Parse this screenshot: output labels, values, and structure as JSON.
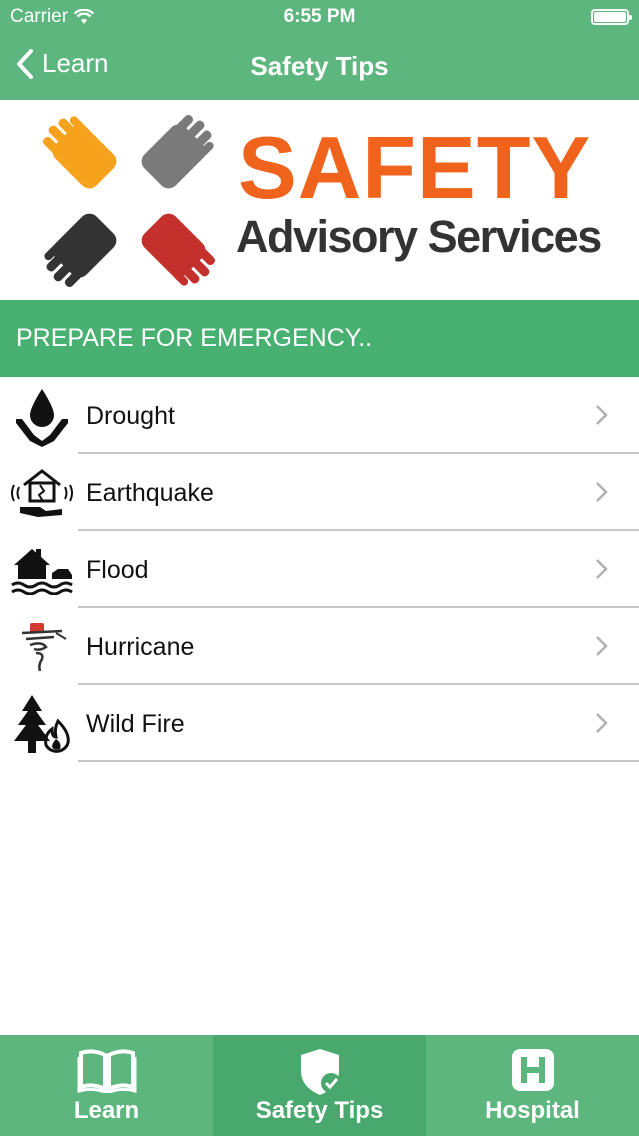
{
  "status_bar": {
    "carrier": "Carrier",
    "time": "6:55 PM"
  },
  "nav": {
    "back_label": "Learn",
    "title": "Safety Tips"
  },
  "banner": {
    "brand_line1": "SAFETY",
    "brand_line2": "Advisory Services"
  },
  "section": {
    "heading": "PREPARE FOR EMERGENCY.."
  },
  "list": {
    "items": [
      {
        "label": "Drought",
        "icon": "drought-icon"
      },
      {
        "label": "Earthquake",
        "icon": "earthquake-icon"
      },
      {
        "label": "Flood",
        "icon": "flood-icon"
      },
      {
        "label": "Hurricane",
        "icon": "hurricane-icon"
      },
      {
        "label": "Wild Fire",
        "icon": "wildfire-icon"
      }
    ]
  },
  "tabbar": {
    "tabs": [
      {
        "label": "Learn",
        "icon": "book-icon",
        "active": false
      },
      {
        "label": "Safety Tips",
        "icon": "shield-check-icon",
        "active": true
      },
      {
        "label": "Hospital",
        "icon": "hospital-icon",
        "active": false
      }
    ]
  },
  "colors": {
    "header_green": "#5cb67e",
    "section_green": "#48b070",
    "brand_orange": "#f0631c",
    "brand_gray": "#333333"
  }
}
